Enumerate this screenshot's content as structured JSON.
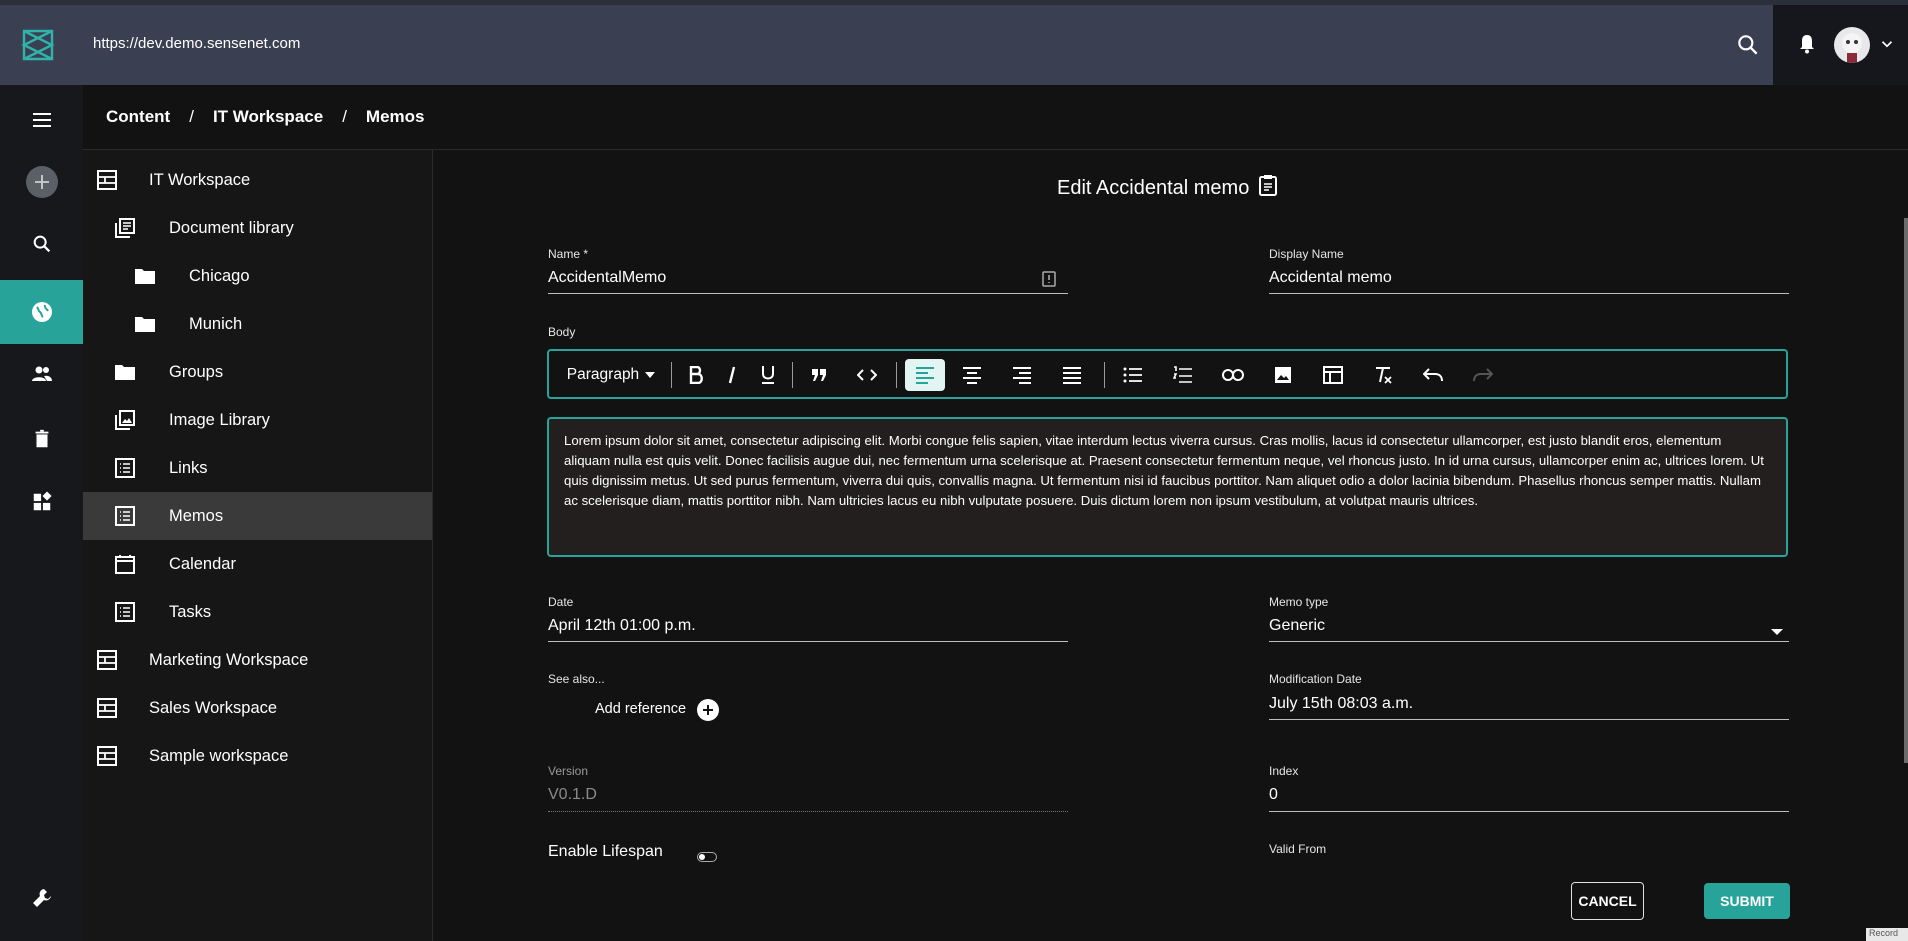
{
  "header": {
    "url": "https://dev.demo.sensenet.com"
  },
  "breadcrumb": {
    "items": [
      "Content",
      "IT Workspace",
      "Memos"
    ],
    "separator": "/"
  },
  "tree": {
    "items": [
      {
        "label": "IT Workspace",
        "icon": "workspace-icon"
      },
      {
        "label": "Document library",
        "icon": "library-icon"
      },
      {
        "label": "Chicago",
        "icon": "folder-icon"
      },
      {
        "label": "Munich",
        "icon": "folder-icon"
      },
      {
        "label": "Groups",
        "icon": "folder-icon"
      },
      {
        "label": "Image Library",
        "icon": "image-library-icon"
      },
      {
        "label": "Links",
        "icon": "list-icon"
      },
      {
        "label": "Memos",
        "icon": "list-icon"
      },
      {
        "label": "Calendar",
        "icon": "calendar-icon"
      },
      {
        "label": "Tasks",
        "icon": "list-icon"
      },
      {
        "label": "Marketing Workspace",
        "icon": "workspace-icon"
      },
      {
        "label": "Sales Workspace",
        "icon": "workspace-icon"
      },
      {
        "label": "Sample workspace",
        "icon": "workspace-icon"
      }
    ],
    "selected": "Memos"
  },
  "form": {
    "title": "Edit Accidental memo",
    "name_label": "Name *",
    "name_value": "AccidentalMemo",
    "display_name_label": "Display Name",
    "display_name_value": "Accidental memo",
    "body_label": "Body",
    "paragraph_label": "Paragraph",
    "body_text": "Lorem ipsum dolor sit amet, consectetur adipiscing elit. Morbi congue felis sapien, vitae interdum lectus viverra cursus. Cras mollis, lacus id consectetur ullamcorper, est justo blandit eros, elementum aliquam nulla est quis velit. Donec facilisis augue dui, nec fermentum urna scelerisque at. Praesent consectetur fermentum neque, vel rhoncus justo. In id urna cursus, ullamcorper enim ac, ultrices lorem. Ut quis dignissim metus. Ut sed purus fermentum, viverra dui quis, convallis magna. Ut fermentum nisi id faucibus porttitor. Nam aliquet odio a dolor lacinia bibendum. Phasellus rhoncus semper mattis. Nullam ac scelerisque diam, mattis porttitor nibh. Nam ultricies lacus eu nibh vulputate posuere. Duis dictum lorem non ipsum vestibulum, at volutpat mauris ultrices.",
    "date_label": "Date",
    "date_value": "April 12th 01:00 p.m.",
    "memo_type_label": "Memo type",
    "memo_type_value": "Generic",
    "see_also_label": "See also...",
    "add_reference_label": "Add reference",
    "modification_date_label": "Modification Date",
    "modification_date_value": "July 15th 08:03 a.m.",
    "version_label": "Version",
    "version_value": "V0.1.D",
    "index_label": "Index",
    "index_value": "0",
    "enable_lifespan_label": "Enable Lifespan",
    "enable_lifespan_on": false,
    "valid_from_label": "Valid From",
    "cancel_label": "CANCEL",
    "submit_label": "SUBMIT"
  },
  "status": {
    "record_tag": "Record"
  },
  "colors": {
    "accent": "#27a399",
    "header_bg": "#3a4052",
    "background": "#121212"
  }
}
